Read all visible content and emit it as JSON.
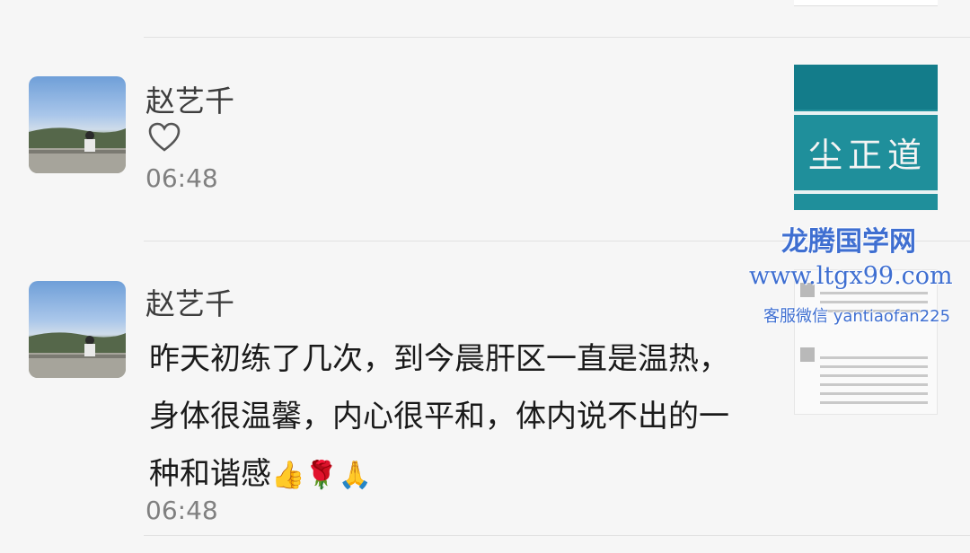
{
  "feed": {
    "entries": [
      {
        "name": "赵艺千",
        "reaction": "heart",
        "time": "06:48"
      },
      {
        "name": "赵艺千",
        "comment_lines": [
          "昨天初练了几次，到今晨肝区一直是温热，",
          "身体很温馨，内心很平和，体内说不出的一",
          "种和谐感"
        ],
        "comment_emojis": "👍🌹🙏",
        "time": "06:48"
      }
    ]
  },
  "thumbnail": {
    "banner_text": "尘正道"
  },
  "watermark": {
    "title": "龙腾国学网",
    "url": "www.ltgx99.com",
    "contact": "客服微信 yantiaofan225"
  },
  "colors": {
    "watermark": "#3f6fd1",
    "banner": "#1f8f9b",
    "divider": "#e2e2e2"
  }
}
